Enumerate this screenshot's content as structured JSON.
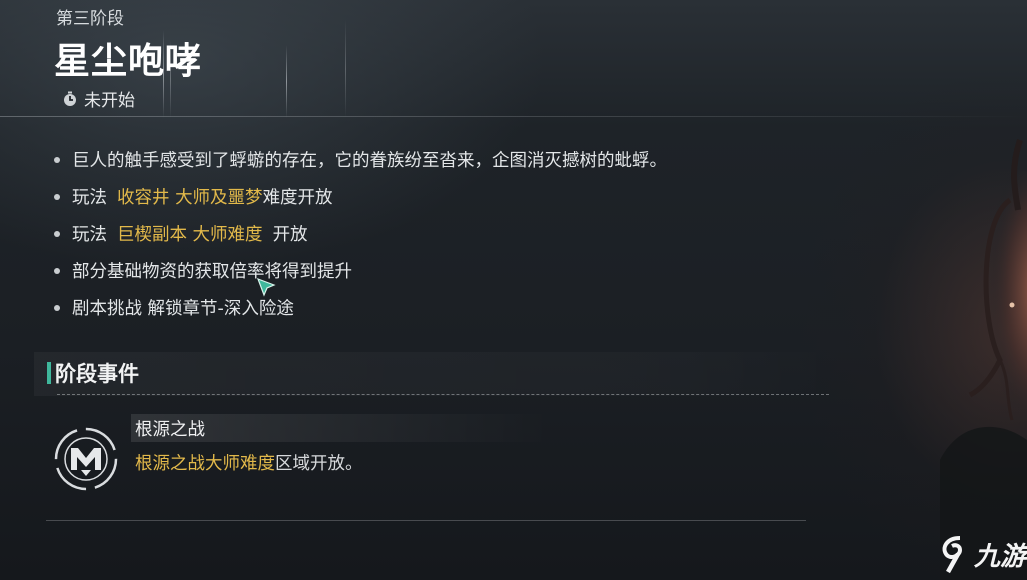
{
  "stage": {
    "label": "第三阶段",
    "title": "星尘咆哮",
    "status_icon": "timer-icon",
    "status": "未开始"
  },
  "bullets": [
    {
      "parts": [
        {
          "text": "巨人的触手感受到了蜉蝣的存在，它的眷族纷至沓来，企图消灭撼树的蚍蜉。",
          "hl": false
        }
      ]
    },
    {
      "parts": [
        {
          "text": "玩法",
          "hl": false
        },
        {
          "text": "收容井 大师及噩梦",
          "hl": true
        },
        {
          "text": "难度开放",
          "hl": false
        }
      ]
    },
    {
      "parts": [
        {
          "text": "玩法",
          "hl": false
        },
        {
          "text": "巨楔副本 大师难度",
          "hl": true
        },
        {
          "text": "开放",
          "hl": false
        }
      ]
    },
    {
      "parts": [
        {
          "text": "部分基础物资的获取倍率将得到提升",
          "hl": false
        }
      ]
    },
    {
      "parts": [
        {
          "text": "剧本挑战 解锁章节-深入险途",
          "hl": false
        }
      ]
    }
  ],
  "section": {
    "title": "阶段事件"
  },
  "event": {
    "icon": "emblem-icon",
    "name": "根源之战",
    "desc_highlight": "根源之战大师难度",
    "desc_rest": "区域开放。"
  },
  "watermark": {
    "text": "九游"
  },
  "colors": {
    "highlight": "#e2b94a",
    "accent": "#3fb79c",
    "text": "#e3e6e8"
  }
}
